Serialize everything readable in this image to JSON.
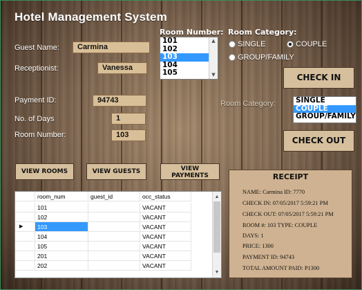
{
  "app": {
    "title": "Hotel Management System"
  },
  "guest": {
    "name_label": "Guest Name:",
    "name_value": "Carmina",
    "receptionist_label": "Receptionist:",
    "receptionist_value": "Vanessa",
    "payment_label": "Payment ID:",
    "payment_value": "94743",
    "days_label": "No. of Days",
    "days_value": "1",
    "room_label": "Room Number:",
    "room_value": "103"
  },
  "room_list": {
    "label": "Room Number:",
    "items": [
      "101",
      "102",
      "103",
      "104",
      "105"
    ],
    "selected": "103"
  },
  "category_radio": {
    "label": "Room Category:",
    "options": [
      {
        "label": "SINGLE",
        "checked": false
      },
      {
        "label": "COUPLE",
        "checked": true
      },
      {
        "label": "GROUP/FAMILY",
        "checked": false
      }
    ]
  },
  "category_list": {
    "label": "Room Category:",
    "items": [
      "SINGLE",
      "COUPLE",
      "GROUP/FAMILY"
    ],
    "selected": "COUPLE"
  },
  "actions": {
    "check_in": "CHECK IN",
    "check_out": "CHECK OUT",
    "view_rooms": "VIEW ROOMS",
    "view_guests": "VIEW GUESTS",
    "view_payments_1": "VIEW",
    "view_payments_2": "PAYMENTS"
  },
  "receipt": {
    "title": "RECEIPT",
    "lines": [
      "NAME:  Carmina    ID: 7770",
      "CHECK IN: 07/05/2017 5:59:21 PM",
      "CHECK OUT: 07/05/2017 5:59:21 PM",
      "ROOM #: 103   TYPE: COUPLE",
      "DAYS: 1",
      "PRICE: 1300",
      "PAYMENT ID: 94743",
      "TOTAL AMOUNT PAID:  P1300"
    ]
  },
  "grid": {
    "columns": [
      "room_num",
      "guest_id",
      "occ_status"
    ],
    "rows": [
      [
        "101",
        "",
        "VACANT"
      ],
      [
        "102",
        "",
        "VACANT"
      ],
      [
        "103",
        "",
        "VACANT"
      ],
      [
        "104",
        "",
        "VACANT"
      ],
      [
        "105",
        "",
        "VACANT"
      ],
      [
        "201",
        "",
        "VACANT"
      ],
      [
        "202",
        "",
        "VACANT"
      ]
    ],
    "current_row_index": 2
  },
  "colors": {
    "field_bg": "#d9bf98",
    "selection": "#3399ff",
    "button_bg": "#d6bf9d"
  },
  "icons": {
    "row_pointer": "triangle-right-icon",
    "scroll_up": "chevron-up-icon",
    "scroll_down": "chevron-down-icon"
  }
}
